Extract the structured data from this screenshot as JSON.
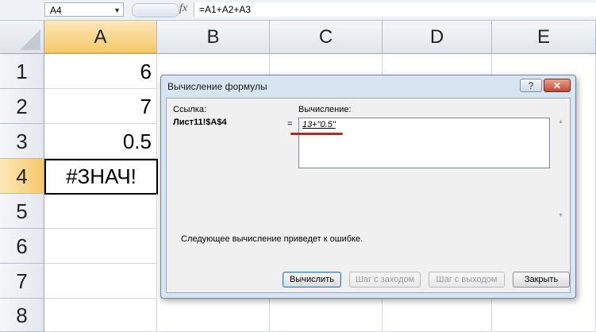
{
  "formula_bar": {
    "cell_reference": "A4",
    "fx_label": "fx",
    "formula": "=A1+A2+A3"
  },
  "columns": [
    "A",
    "B",
    "C",
    "D",
    "E"
  ],
  "rows": [
    "1",
    "2",
    "3",
    "4",
    "5",
    "6",
    "7",
    "8"
  ],
  "cells": {
    "A1": "6",
    "A2": "7",
    "A3": "0.5",
    "A4": "#ЗНАЧ!"
  },
  "dialog": {
    "title": "Вычисление формулы",
    "help_label": "?",
    "close_label": "✕",
    "reference_label": "Ссылка:",
    "reference_value": "Лист11!$A$4",
    "equals": "=",
    "evaluation_label": "Вычисление:",
    "evaluation_value": "13+\"0.5\"",
    "message": "Следующее вычисление приведет к ошибке.",
    "buttons": {
      "evaluate": "Вычислить",
      "step_in": "Шаг с заходом",
      "step_out": "Шаг с выходом",
      "close": "Закрыть"
    }
  },
  "colors": {
    "selected_header": "#f6c86a",
    "dialog_background": "#d7e4f2",
    "annotation_red": "#e0141c"
  }
}
